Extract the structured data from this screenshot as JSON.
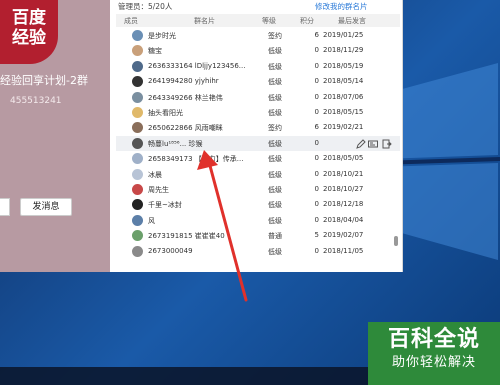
{
  "group": {
    "logo_text": "百度\n经验",
    "name": "经验回享计划-2群",
    "id": "455513241",
    "send_message_label": "发消息"
  },
  "member_panel": {
    "admin_label": "管理员：5/20人",
    "edit_card_link": "修改我的群名片",
    "columns": {
      "member": "成员",
      "card": "群名片",
      "level": "等级",
      "points": "积分",
      "last_speak": "最后发言"
    },
    "rows": [
      {
        "name": "是步时光",
        "level": "签约",
        "points": "6",
        "date": "2019/01/25",
        "avatar_color": "#6a8fb5"
      },
      {
        "name": "糖宝",
        "level": "低级",
        "points": "0",
        "date": "2018/11/29",
        "avatar_color": "#c9a07a"
      },
      {
        "name": "2636333164  lDljjy123456...",
        "level": "低级",
        "points": "0",
        "date": "2018/05/19",
        "avatar_color": "#4f6a8a"
      },
      {
        "name": "2641994280  yjyhihr",
        "level": "低级",
        "points": "0",
        "date": "2018/05/14",
        "avatar_color": "#333333"
      },
      {
        "name": "2643349266  林兰艳伟",
        "level": "低级",
        "points": "0",
        "date": "2018/07/06",
        "avatar_color": "#7a8fa0"
      },
      {
        "name": "抽头看阳光",
        "level": "低级",
        "points": "0",
        "date": "2018/05/15",
        "avatar_color": "#e0b96a"
      },
      {
        "name": "2650622866  风雨嘲眯",
        "level": "签约",
        "points": "6",
        "date": "2019/02/21",
        "avatar_color": "#8a6e5a"
      },
      {
        "name": "畅蔓lu¹⁸⁵⁶...  珍猴",
        "level": "低级",
        "points": "0",
        "date": "",
        "avatar_color": "#555555"
      },
      {
        "name": "2658349173  【聚力】传承...",
        "level": "低级",
        "points": "0",
        "date": "2018/05/05",
        "avatar_color": "#9fb0c8"
      },
      {
        "name": "冰晨",
        "level": "低级",
        "points": "0",
        "date": "2018/10/21",
        "avatar_color": "#b8c4d6"
      },
      {
        "name": "周先生",
        "level": "低级",
        "points": "0",
        "date": "2018/10/27",
        "avatar_color": "#c84848"
      },
      {
        "name": "千里~冰封",
        "level": "低级",
        "points": "0",
        "date": "2018/12/18",
        "avatar_color": "#222222"
      },
      {
        "name": "风",
        "level": "低级",
        "points": "0",
        "date": "2018/04/04",
        "avatar_color": "#5c7fa8"
      },
      {
        "name": "2673191815  崔崔崔40",
        "level": "普通",
        "points": "5",
        "date": "2019/02/07",
        "avatar_color": "#6ba06b"
      },
      {
        "name": "2673000049",
        "level": "低级",
        "points": "0",
        "date": "2018/11/05",
        "avatar_color": "#8a8a8a"
      }
    ]
  },
  "watermark": {
    "title": "百科全说",
    "subtitle": "助你轻松解决"
  },
  "colors": {
    "annotation_arrow": "#e0312b",
    "watermark_bg": "#2e8a3a",
    "link": "#2a7ad8"
  },
  "icons": [
    "edit-icon",
    "card-icon",
    "transfer-icon"
  ]
}
